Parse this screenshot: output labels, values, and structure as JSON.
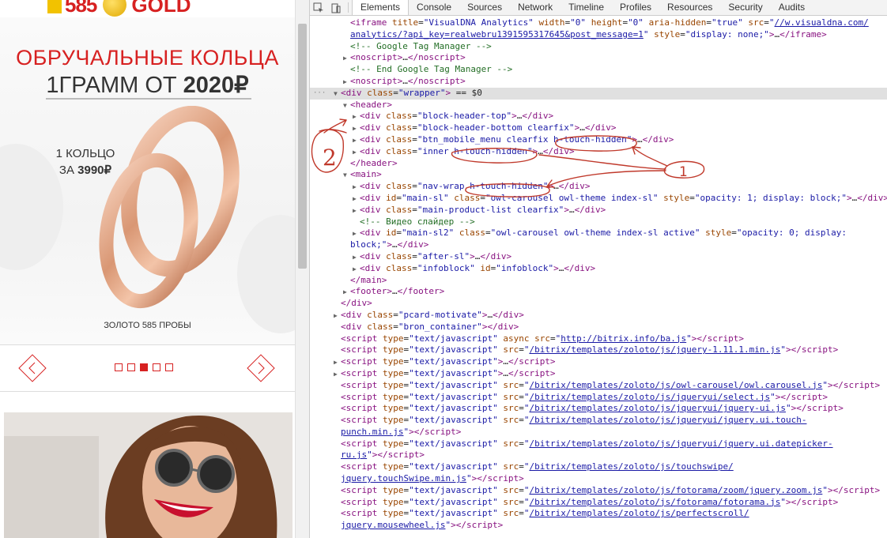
{
  "site": {
    "logo_num": "585",
    "logo_gold": "GOLD",
    "headline": "ОБРУЧАЛЬНЫЕ КОЛЬЦА",
    "subline_pre": "1ГРАММ ОТ ",
    "subline_price": "2020₽",
    "one_ring_1": "1 КОЛЬЦО",
    "one_ring_2_pre": "ЗА ",
    "one_ring_2_price": "3990₽",
    "gold585": "ЗОЛОТО 585 ПРОБЫ",
    "dots": 5,
    "active_dot": 2,
    "accent": "#d72121"
  },
  "devtools": {
    "tabs": [
      "Elements",
      "Console",
      "Sources",
      "Network",
      "Timeline",
      "Profiles",
      "Resources",
      "Security",
      "Audits"
    ],
    "active_tab": "Elements",
    "icons": [
      "inspect-icon",
      "device-icon"
    ]
  },
  "annotations": [
    "1",
    "2"
  ],
  "code_lines": [
    {
      "i": 1,
      "tri": "",
      "h": "<span class='t'>&lt;iframe</span> <span class='a'>title</span>=<span class='v'>\"VisualDNA Analytics\"</span> <span class='a'>width</span>=<span class='v'>\"0\"</span> <span class='a'>height</span>=<span class='v'>\"0\"</span> <span class='a'>aria-hidden</span>=<span class='v'>\"true\"</span> <span class='a'>src</span>=<span class='v'>\"</span><span class='u'>//w.visualdna.com/</span>"
    },
    {
      "i": 1,
      "tri": "",
      "h": "<span class='u'>analytics/?api_key=realwebru1391595317645&amp;post_message=1</span><span class='v'>\"</span> <span class='a'>style</span>=<span class='v'>\"display: none;\"</span><span class='t'>&gt;</span>…<span class='t'>&lt;/iframe&gt;</span>"
    },
    {
      "i": 1,
      "tri": "",
      "h": "<span class='c'>&lt;!-- Google Tag Manager --&gt;</span>"
    },
    {
      "i": 1,
      "tri": "▶",
      "h": "<span class='t'>&lt;noscript&gt;</span>…<span class='t'>&lt;/noscript&gt;</span>"
    },
    {
      "i": 1,
      "tri": "",
      "h": "<span class='c'>&lt;!-- End Google Tag Manager --&gt;</span>"
    },
    {
      "i": 1,
      "tri": "▶",
      "h": "<span class='t'>&lt;noscript&gt;</span>…<span class='t'>&lt;/noscript&gt;</span>"
    },
    {
      "i": 0,
      "tri": "▼",
      "sel": true,
      "h": "<span class='t'>&lt;div</span> <span class='a'>class</span>=<span class='v'>\"wrapper\"</span><span class='t'>&gt;</span> <span class='e'>== $0</span>"
    },
    {
      "i": 1,
      "tri": "▼",
      "h": "<span class='t'>&lt;header&gt;</span>"
    },
    {
      "i": 2,
      "tri": "▶",
      "h": "<span class='t'>&lt;div</span> <span class='a'>class</span>=<span class='v'>\"block-header-top\"</span><span class='t'>&gt;</span>…<span class='t'>&lt;/div&gt;</span>"
    },
    {
      "i": 2,
      "tri": "▶",
      "h": "<span class='t'>&lt;div</span> <span class='a'>class</span>=<span class='v'>\"block-header-bottom clearfix\"</span><span class='t'>&gt;</span>…<span class='t'>&lt;/div&gt;</span>"
    },
    {
      "i": 2,
      "tri": "▶",
      "h": "<span class='t'>&lt;div</span> <span class='a'>class</span>=<span class='v'>\"btn_mobile_menu clearfix  h-touch-hidden\"</span><span class='t'>&gt;</span>…<span class='t'>&lt;/div&gt;</span>"
    },
    {
      "i": 2,
      "tri": "▶",
      "h": "<span class='t'>&lt;div</span> <span class='a'>class</span>=<span class='v'>\"inner  h-touch-hidden\"</span><span class='t'>&gt;</span>…<span class='t'>&lt;/div&gt;</span>"
    },
    {
      "i": 1,
      "tri": "",
      "h": "<span class='t'>&lt;/header&gt;</span>"
    },
    {
      "i": 1,
      "tri": "▼",
      "h": "<span class='t'>&lt;main&gt;</span>"
    },
    {
      "i": 2,
      "tri": "▶",
      "h": "<span class='t'>&lt;div</span> <span class='a'>class</span>=<span class='v'>\"nav-wrap  h-touch-hidden\"</span><span class='t'>&gt;</span>…<span class='t'>&lt;/div&gt;</span>"
    },
    {
      "i": 2,
      "tri": "▶",
      "h": "<span class='t'>&lt;div</span> <span class='a'>id</span>=<span class='v'>\"main-sl\"</span> <span class='a'>class</span>=<span class='v'>\"owl-carousel owl-theme index-sl\"</span> <span class='a'>style</span>=<span class='v'>\"opacity: 1; display: block;\"</span><span class='t'>&gt;</span>…<span class='t'>&lt;/div&gt;</span>"
    },
    {
      "i": 2,
      "tri": "▶",
      "h": "<span class='t'>&lt;div</span> <span class='a'>class</span>=<span class='v'>\"main-product-list clearfix\"</span><span class='t'>&gt;</span>…<span class='t'>&lt;/div&gt;</span>"
    },
    {
      "i": 2,
      "tri": "",
      "h": "<span class='c'>&lt;!--    Видео слайдер --&gt;</span>"
    },
    {
      "i": 2,
      "tri": "▶",
      "h": "<span class='t'>&lt;div</span> <span class='a'>id</span>=<span class='v'>\"main-sl2\"</span> <span class='a'>class</span>=<span class='v'>\"owl-carousel owl-theme index-sl active\"</span> <span class='a'>style</span>=<span class='v'>\"opacity: 0; display:</span>"
    },
    {
      "i": 1,
      "tri": "",
      "h": "<span class='v'>block;\"</span><span class='t'>&gt;</span>…<span class='t'>&lt;/div&gt;</span>"
    },
    {
      "i": 2,
      "tri": "▶",
      "h": "<span class='t'>&lt;div</span> <span class='a'>class</span>=<span class='v'>\"after-sl\"</span><span class='t'>&gt;</span>…<span class='t'>&lt;/div&gt;</span>"
    },
    {
      "i": 2,
      "tri": "▶",
      "h": "<span class='t'>&lt;div</span> <span class='a'>class</span>=<span class='v'>\"infoblock\"</span> <span class='a'>id</span>=<span class='v'>\"infoblock\"</span><span class='t'>&gt;</span>…<span class='t'>&lt;/div&gt;</span>"
    },
    {
      "i": 1,
      "tri": "",
      "h": "<span class='t'>&lt;/main&gt;</span>"
    },
    {
      "i": 1,
      "tri": "▶",
      "h": "<span class='t'>&lt;footer&gt;</span>…<span class='t'>&lt;/footer&gt;</span>"
    },
    {
      "i": 0,
      "tri": "",
      "h": "<span class='t'>&lt;/div&gt;</span>"
    },
    {
      "i": 0,
      "tri": "▶",
      "h": "<span class='t'>&lt;div</span> <span class='a'>class</span>=<span class='v'>\"pcard-motivate\"</span><span class='t'>&gt;</span>…<span class='t'>&lt;/div&gt;</span>"
    },
    {
      "i": 0,
      "tri": "",
      "h": "<span class='t'>&lt;div</span> <span class='a'>class</span>=<span class='v'>\"bron_container\"</span><span class='t'>&gt;&lt;/div&gt;</span>"
    },
    {
      "i": 0,
      "tri": "",
      "h": "<span class='t'>&lt;script</span> <span class='a'>type</span>=<span class='v'>\"text/javascript\"</span> <span class='a'>async</span> <span class='a'>src</span>=<span class='v'>\"</span><span class='u'>http://bitrix.info/ba.js</span><span class='v'>\"</span><span class='t'>&gt;&lt;/script&gt;</span>"
    },
    {
      "i": 0,
      "tri": "",
      "h": "<span class='t'>&lt;script</span> <span class='a'>type</span>=<span class='v'>\"text/javascript\"</span> <span class='a'>src</span>=<span class='v'>\"</span><span class='u'>/bitrix/templates/zoloto/js/jquery-1.11.1.min.js</span><span class='v'>\"</span><span class='t'>&gt;&lt;/script&gt;</span>"
    },
    {
      "i": 0,
      "tri": "▶",
      "h": "<span class='t'>&lt;script</span> <span class='a'>type</span>=<span class='v'>\"text/javascript\"</span><span class='t'>&gt;</span>…<span class='t'>&lt;/script&gt;</span>"
    },
    {
      "i": 0,
      "tri": "▶",
      "h": "<span class='t'>&lt;script</span> <span class='a'>type</span>=<span class='v'>\"text/javascript\"</span><span class='t'>&gt;</span>…<span class='t'>&lt;/script&gt;</span>"
    },
    {
      "i": 0,
      "tri": "",
      "h": "<span class='t'>&lt;script</span> <span class='a'>type</span>=<span class='v'>\"text/javascript\"</span> <span class='a'>src</span>=<span class='v'>\"</span><span class='u'>/bitrix/templates/zoloto/js/owl-carousel/owl.carousel.js</span><span class='v'>\"</span><span class='t'>&gt;&lt;/script&gt;</span>"
    },
    {
      "i": 0,
      "tri": "",
      "h": "<span class='t'>&lt;script</span> <span class='a'>type</span>=<span class='v'>\"text/javascript\"</span> <span class='a'>src</span>=<span class='v'>\"</span><span class='u'>/bitrix/templates/zoloto/js/jqueryui/select.js</span><span class='v'>\"</span><span class='t'>&gt;&lt;/script&gt;</span>"
    },
    {
      "i": 0,
      "tri": "",
      "h": "<span class='t'>&lt;script</span> <span class='a'>type</span>=<span class='v'>\"text/javascript\"</span> <span class='a'>src</span>=<span class='v'>\"</span><span class='u'>/bitrix/templates/zoloto/js/jqueryui/jquery-ui.js</span><span class='v'>\"</span><span class='t'>&gt;&lt;/script&gt;</span>"
    },
    {
      "i": 0,
      "tri": "",
      "h": "<span class='t'>&lt;script</span> <span class='a'>type</span>=<span class='v'>\"text/javascript\"</span> <span class='a'>src</span>=<span class='v'>\"</span><span class='u'>/bitrix/templates/zoloto/js/jqueryui/jquery.ui.touch-</span>"
    },
    {
      "i": 0,
      "tri": "",
      "h": "<span class='u'>punch.min.js</span><span class='v'>\"</span><span class='t'>&gt;&lt;/script&gt;</span>"
    },
    {
      "i": 0,
      "tri": "",
      "h": "<span class='t'>&lt;script</span> <span class='a'>type</span>=<span class='v'>\"text/javascript\"</span> <span class='a'>src</span>=<span class='v'>\"</span><span class='u'>/bitrix/templates/zoloto/js/jqueryui/jquery.ui.datepicker-</span>"
    },
    {
      "i": 0,
      "tri": "",
      "h": "<span class='u'>ru.js</span><span class='v'>\"</span><span class='t'>&gt;&lt;/script&gt;</span>"
    },
    {
      "i": 0,
      "tri": "",
      "h": "<span class='t'>&lt;script</span> <span class='a'>type</span>=<span class='v'>\"text/javascript\"</span> <span class='a'>src</span>=<span class='v'>\"</span><span class='u'>/bitrix/templates/zoloto/js/touchswipe/</span>"
    },
    {
      "i": 0,
      "tri": "",
      "h": "<span class='u'>jquery.touchSwipe.min.js</span><span class='v'>\"</span><span class='t'>&gt;&lt;/script&gt;</span>"
    },
    {
      "i": 0,
      "tri": "",
      "h": "<span class='t'>&lt;script</span> <span class='a'>type</span>=<span class='v'>\"text/javascript\"</span> <span class='a'>src</span>=<span class='v'>\"</span><span class='u'>/bitrix/templates/zoloto/js/fotorama/zoom/jquery.zoom.js</span><span class='v'>\"</span><span class='t'>&gt;&lt;/script&gt;</span>"
    },
    {
      "i": 0,
      "tri": "",
      "h": "<span class='t'>&lt;script</span> <span class='a'>type</span>=<span class='v'>\"text/javascript\"</span> <span class='a'>src</span>=<span class='v'>\"</span><span class='u'>/bitrix/templates/zoloto/js/fotorama/fotorama.js</span><span class='v'>\"</span><span class='t'>&gt;&lt;/script&gt;</span>"
    },
    {
      "i": 0,
      "tri": "",
      "h": "<span class='t'>&lt;script</span> <span class='a'>type</span>=<span class='v'>\"text/javascript\"</span> <span class='a'>src</span>=<span class='v'>\"</span><span class='u'>/bitrix/templates/zoloto/js/perfectscroll/</span>"
    },
    {
      "i": 0,
      "tri": "",
      "h": "<span class='u'>jquery.mousewheel.js</span><span class='v'>\"</span><span class='t'>&gt;&lt;/script&gt;</span>"
    }
  ]
}
